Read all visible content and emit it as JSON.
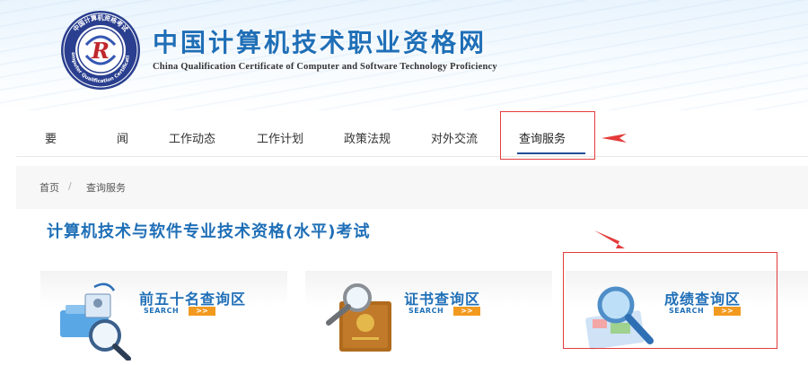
{
  "header": {
    "title": "中国计算机技术职业资格网",
    "subtitle": "China Qualification Certificate of Computer and Software Technology Proficiency",
    "logo_ring_text": "中国计算机资格考试 · Computer Qualification Certification",
    "logo_letter": "R"
  },
  "nav": {
    "items": [
      {
        "label": "要"
      },
      {
        "label": "闻"
      },
      {
        "label": "工作动态"
      },
      {
        "label": "工作计划"
      },
      {
        "label": "政策法规"
      },
      {
        "label": "对外交流"
      },
      {
        "label": "查询服务",
        "active": true
      }
    ]
  },
  "breadcrumb": {
    "home": "首页",
    "separator": "/",
    "current": "查询服务"
  },
  "main": {
    "section_title": "计算机技术与软件专业技术资格(水平)考试",
    "cards": [
      {
        "title": "前五十名查询区",
        "search": "SEARCH",
        "go": ">>",
        "icon": "id-badge-magnifier-icon"
      },
      {
        "title": "证书查询区",
        "search": "SEARCH",
        "go": ">>",
        "icon": "certificate-magnifier-icon"
      },
      {
        "title": "成绩查询区",
        "search": "SEARCH",
        "go": ">>",
        "icon": "score-magnifier-icon"
      }
    ]
  },
  "colors": {
    "brand_blue": "#1f6fb7",
    "nav_underline": "#1f4f96",
    "annotation_red": "#e43b3b",
    "search_orange": "#f29a1f"
  }
}
